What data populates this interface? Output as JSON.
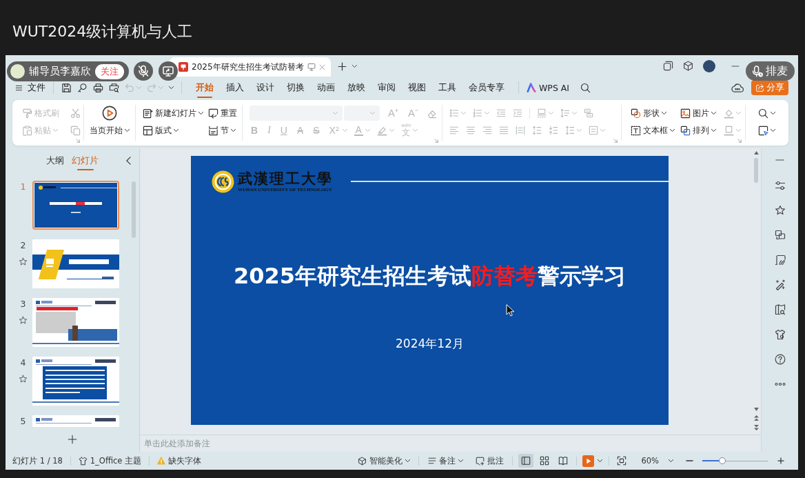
{
  "meeting": {
    "title": "WUT2024级计算机与人工",
    "presenter": "辅导员李嘉欣",
    "follow_button": "关注",
    "mic_muted": true,
    "queue_button": "排麦"
  },
  "window": {
    "tabs": [
      {
        "label": "2025年研究生招生考试防替考",
        "selected": true
      }
    ]
  },
  "menu": {
    "file": "文件",
    "undo": {
      "disabled": true
    },
    "redo": {
      "disabled": true
    },
    "tabs": [
      {
        "label": "开始",
        "selected": true
      },
      {
        "label": "插入",
        "selected": false
      },
      {
        "label": "设计",
        "selected": false
      },
      {
        "label": "切换",
        "selected": false
      },
      {
        "label": "动画",
        "selected": false
      },
      {
        "label": "放映",
        "selected": false
      },
      {
        "label": "审阅",
        "selected": false
      },
      {
        "label": "视图",
        "selected": false
      },
      {
        "label": "工具",
        "selected": false
      },
      {
        "label": "会员专享",
        "selected": false
      }
    ],
    "ai_button": "WPS AI",
    "share_button": "分享"
  },
  "ribbon": {
    "groups": [
      {
        "kind": "clipboard",
        "disabled": true,
        "rows": [
          [
            {
              "kind": "format-painter",
              "label": "格式刷",
              "dropdown": false
            },
            {
              "kind": "cut",
              "dropdown": false
            }
          ],
          [
            {
              "kind": "paste",
              "label": "粘贴",
              "dropdown": true
            },
            {
              "kind": "copy",
              "dropdown": false
            }
          ]
        ]
      },
      {
        "kind": "slideshow",
        "disabled": false,
        "rows": [
          [
            {
              "kind": "play-current",
              "label": "当页开始",
              "dropdown": true
            }
          ]
        ]
      },
      {
        "kind": "slides",
        "disabled": false,
        "rows": [
          [
            {
              "kind": "new-slide",
              "label": "新建幻灯片",
              "dropdown": true
            },
            {
              "kind": "reset",
              "label": "重置",
              "dropdown": false
            }
          ],
          [
            {
              "kind": "layout",
              "label": "版式",
              "dropdown": true
            },
            {
              "kind": "section",
              "label": "节",
              "dropdown": true
            }
          ]
        ]
      },
      {
        "kind": "font",
        "disabled": true,
        "rows": [
          [
            {
              "kind": "grow",
              "label": "A⁺",
              "dropdown": false
            },
            {
              "kind": "shrink",
              "label": "A⁻",
              "dropdown": false
            },
            {
              "kind": "clear",
              "dropdown": false
            }
          ],
          [
            {
              "kind": "bold",
              "label": "B",
              "dropdown": false
            },
            {
              "kind": "italic",
              "label": "I",
              "dropdown": false
            },
            {
              "kind": "underline",
              "label": "U",
              "dropdown": false
            },
            {
              "kind": "strike",
              "label": "A",
              "dropdown": false
            },
            {
              "kind": "double-strike",
              "label": "S",
              "dropdown": false
            },
            {
              "kind": "superscript",
              "label": "X²",
              "dropdown": true
            },
            {
              "kind": "color",
              "label": "A",
              "dropdown": true
            },
            {
              "kind": "highlight",
              "dropdown": true
            },
            {
              "kind": "phonetic",
              "ruby": "wén",
              "label": "文",
              "dropdown": true
            }
          ]
        ]
      },
      {
        "kind": "paragraph",
        "disabled": true,
        "rows": [
          [
            {
              "kind": "bullets",
              "dropdown": true
            },
            {
              "kind": "numbering",
              "dropdown": true
            },
            {
              "kind": "outdent",
              "dropdown": false
            },
            {
              "kind": "indent",
              "dropdown": false
            },
            {
              "kind": "text-direction",
              "dropdown": true
            },
            {
              "kind": "align-text",
              "dropdown": true
            },
            {
              "kind": "smartart",
              "dropdown": false
            }
          ],
          [
            {
              "kind": "align-left",
              "dropdown": false
            },
            {
              "kind": "align-center",
              "dropdown": false
            },
            {
              "kind": "align-right",
              "dropdown": false
            },
            {
              "kind": "justify",
              "dropdown": false
            },
            {
              "kind": "distribute",
              "dropdown": false
            },
            {
              "kind": "spacing-up",
              "dropdown": false
            },
            {
              "kind": "spacing-down",
              "dropdown": false
            },
            {
              "kind": "line-spacing",
              "dropdown": true
            },
            {
              "kind": "text-align",
              "dropdown": true
            }
          ]
        ]
      },
      {
        "kind": "insert",
        "disabled": false,
        "rows": [
          [
            {
              "kind": "shapes",
              "label": "形状",
              "dropdown": true,
              "disabled": false
            },
            {
              "kind": "picture",
              "label": "图片",
              "dropdown": true,
              "disabled": false
            },
            {
              "kind": "fill",
              "dropdown": true,
              "disabled": true
            }
          ],
          [
            {
              "kind": "textbox",
              "label": "文本框",
              "dropdown": true,
              "disabled": false
            },
            {
              "kind": "arrange",
              "label": "排列",
              "dropdown": true,
              "disabled": false
            },
            {
              "kind": "outline",
              "dropdown": true,
              "disabled": true
            }
          ]
        ]
      },
      {
        "kind": "find",
        "disabled": false,
        "rows": [
          [
            {
              "kind": "search",
              "dropdown": true
            }
          ],
          [
            {
              "kind": "select",
              "dropdown": true
            }
          ]
        ]
      }
    ]
  },
  "slides_panel": {
    "tabs": [
      {
        "label": "大纲",
        "selected": false
      },
      {
        "label": "幻灯片",
        "selected": true
      }
    ],
    "thumbnails": [
      {
        "number": "1",
        "kind": "title",
        "selected": true,
        "animation": false
      },
      {
        "number": "2",
        "kind": "section",
        "selected": false,
        "animation": true
      },
      {
        "number": "3",
        "kind": "picture",
        "selected": false,
        "animation": true
      },
      {
        "number": "4",
        "kind": "text",
        "selected": false,
        "animation": true
      },
      {
        "number": "5",
        "kind": "header",
        "selected": false,
        "animation": false
      }
    ]
  },
  "slide": {
    "logo_name": "武漢理工大學",
    "logo_subtitle": "WUHAN UNIVERSITY OF TECHNOLOGY",
    "title_parts": [
      {
        "text": "2025年研究生招生考试",
        "color": "#ffffff"
      },
      {
        "text": "防替考",
        "color": "#ff1a1a"
      },
      {
        "text": "警示学习",
        "color": "#ffffff"
      }
    ],
    "date": "2024年12月"
  },
  "notes": {
    "placeholder": "单击此处添加备注"
  },
  "status_bar": {
    "slide_counter": "幻灯片 1 / 18",
    "theme": "1_Office 主题",
    "missing_font": "缺失字体",
    "beautify": "智能美化",
    "notes": "备注",
    "comments": "批注",
    "views": [
      {
        "kind": "normal",
        "selected": true
      },
      {
        "kind": "sorter",
        "selected": false
      },
      {
        "kind": "reading",
        "selected": false
      }
    ],
    "zoom": "60%",
    "zoom_slider": {
      "level": 0.3
    }
  }
}
